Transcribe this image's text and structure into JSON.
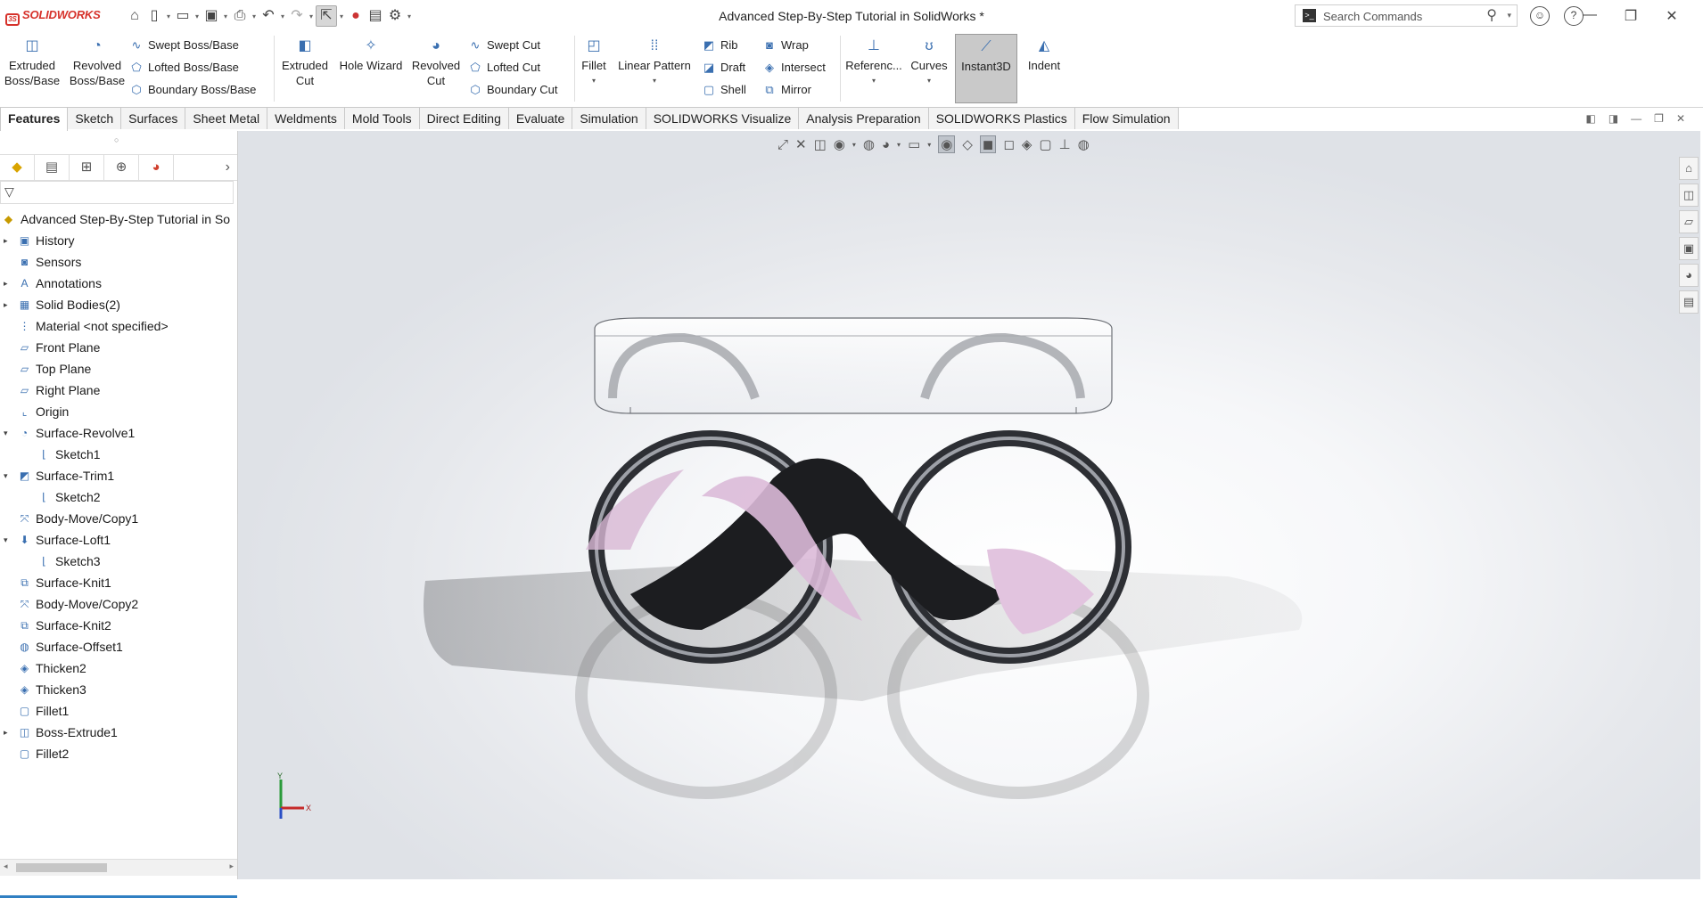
{
  "app": {
    "brand": "SOLIDWORKS",
    "window_title": "Advanced Step-By-Step Tutorial in SolidWorks *"
  },
  "search": {
    "placeholder": "Search Commands"
  },
  "ribbon": {
    "extruded_boss": [
      "Extruded",
      "Boss/Base"
    ],
    "revolved_boss": [
      "Revolved",
      "Boss/Base"
    ],
    "swept_boss": "Swept Boss/Base",
    "lofted_boss": "Lofted Boss/Base",
    "boundary_boss": "Boundary Boss/Base",
    "extruded_cut": [
      "Extruded",
      "Cut"
    ],
    "hole_wizard": "Hole Wizard",
    "revolved_cut": [
      "Revolved",
      "Cut"
    ],
    "swept_cut": "Swept Cut",
    "lofted_cut": "Lofted Cut",
    "boundary_cut": "Boundary Cut",
    "fillet": "Fillet",
    "linear_pattern": "Linear Pattern",
    "rib": "Rib",
    "draft": "Draft",
    "shell": "Shell",
    "wrap": "Wrap",
    "intersect": "Intersect",
    "mirror": "Mirror",
    "reference": "Referenc...",
    "curves": "Curves",
    "instant3d": "Instant3D",
    "indent": "Indent"
  },
  "tabs": [
    "Features",
    "Sketch",
    "Surfaces",
    "Sheet Metal",
    "Weldments",
    "Mold Tools",
    "Direct Editing",
    "Evaluate",
    "Simulation",
    "SOLIDWORKS Visualize",
    "Analysis Preparation",
    "SOLIDWORKS Plastics",
    "Flow Simulation"
  ],
  "tree": {
    "root": "Advanced Step-By-Step Tutorial in So",
    "items": [
      {
        "label": "History",
        "icon": "history-folder-icon",
        "expandable": true,
        "level": 1
      },
      {
        "label": "Sensors",
        "icon": "sensors-icon",
        "expandable": false,
        "level": 1
      },
      {
        "label": "Annotations",
        "icon": "annotations-icon",
        "expandable": true,
        "level": 1
      },
      {
        "label": "Solid Bodies(2)",
        "icon": "solid-bodies-icon",
        "expandable": true,
        "level": 1
      },
      {
        "label": "Material <not specified>",
        "icon": "material-icon",
        "expandable": false,
        "level": 1
      },
      {
        "label": "Front Plane",
        "icon": "plane-icon",
        "expandable": false,
        "level": 1
      },
      {
        "label": "Top Plane",
        "icon": "plane-icon",
        "expandable": false,
        "level": 1
      },
      {
        "label": "Right Plane",
        "icon": "plane-icon",
        "expandable": false,
        "level": 1
      },
      {
        "label": "Origin",
        "icon": "origin-icon",
        "expandable": false,
        "level": 1
      },
      {
        "label": "Surface-Revolve1",
        "icon": "surface-revolve-icon",
        "expandable": true,
        "expanded": true,
        "level": 1
      },
      {
        "label": "Sketch1",
        "icon": "sketch-icon",
        "expandable": false,
        "level": 2
      },
      {
        "label": "Surface-Trim1",
        "icon": "surface-trim-icon",
        "expandable": true,
        "expanded": true,
        "level": 1
      },
      {
        "label": "Sketch2",
        "icon": "sketch-icon",
        "expandable": false,
        "level": 2
      },
      {
        "label": "Body-Move/Copy1",
        "icon": "move-copy-icon",
        "expandable": false,
        "level": 1
      },
      {
        "label": "Surface-Loft1",
        "icon": "surface-loft-icon",
        "expandable": true,
        "expanded": true,
        "level": 1
      },
      {
        "label": "Sketch3",
        "icon": "sketch-icon",
        "expandable": false,
        "level": 2
      },
      {
        "label": "Surface-Knit1",
        "icon": "surface-knit-icon",
        "expandable": false,
        "level": 1
      },
      {
        "label": "Body-Move/Copy2",
        "icon": "move-copy-icon",
        "expandable": false,
        "level": 1
      },
      {
        "label": "Surface-Knit2",
        "icon": "surface-knit-icon",
        "expandable": false,
        "level": 1
      },
      {
        "label": "Surface-Offset1",
        "icon": "surface-offset-icon",
        "expandable": false,
        "level": 1
      },
      {
        "label": "Thicken2",
        "icon": "thicken-icon",
        "expandable": false,
        "level": 1
      },
      {
        "label": "Thicken3",
        "icon": "thicken-icon",
        "expandable": false,
        "level": 1
      },
      {
        "label": "Fillet1",
        "icon": "fillet-icon",
        "expandable": false,
        "level": 1
      },
      {
        "label": "Boss-Extrude1",
        "icon": "boss-extrude-icon",
        "expandable": true,
        "level": 1
      },
      {
        "label": "Fillet2",
        "icon": "fillet-icon",
        "expandable": false,
        "level": 1
      }
    ]
  },
  "triad": {
    "y": "Y",
    "x": "X"
  },
  "colors": {
    "brand_red": "#d6322b",
    "accent_blue": "#2f7fc2",
    "model_pink": "#e2c4df",
    "model_dark": "#1c1d20",
    "glass": "#f6f7f9"
  }
}
